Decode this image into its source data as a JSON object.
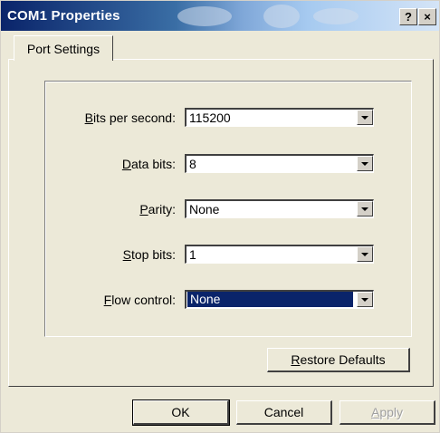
{
  "window": {
    "title": "COM1 Properties",
    "help_button": "?",
    "close_button": "×"
  },
  "tabs": [
    {
      "label": "Port Settings"
    }
  ],
  "settings": [
    {
      "label_key": "B",
      "label_rest": "its per second:",
      "value": "115200"
    },
    {
      "label_key": "D",
      "label_rest": "ata bits:",
      "value": "8"
    },
    {
      "label_key": "P",
      "label_rest": "arity:",
      "value": "None"
    },
    {
      "label_key": "S",
      "label_rest": "top bits:",
      "value": "1"
    },
    {
      "label_key": "F",
      "label_rest": "low control:",
      "value": "None"
    }
  ],
  "buttons": {
    "restore_key": "R",
    "restore_rest": "estore Defaults",
    "ok": "OK",
    "cancel": "Cancel",
    "apply_key": "A",
    "apply_rest": "pply"
  },
  "colors": {
    "selection_bg": "#0a246a",
    "face": "#ece9d8"
  },
  "icons": {
    "combo_arrow": "chevron-down-icon",
    "help": "help-icon",
    "close": "close-icon"
  }
}
